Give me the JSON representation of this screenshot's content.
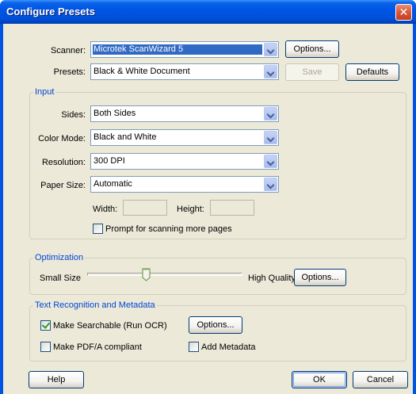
{
  "window": {
    "title": "Configure Presets"
  },
  "scanner": {
    "label": "Scanner:",
    "value": "Microtek ScanWizard 5",
    "options_button": "Options..."
  },
  "presets": {
    "label": "Presets:",
    "value": "Black & White Document",
    "save_button": "Save",
    "defaults_button": "Defaults"
  },
  "input": {
    "group_title": "Input",
    "sides": {
      "label": "Sides:",
      "value": "Both Sides"
    },
    "color_mode": {
      "label": "Color Mode:",
      "value": "Black and White"
    },
    "resolution": {
      "label": "Resolution:",
      "value": "300 DPI"
    },
    "paper_size": {
      "label": "Paper Size:",
      "value": "Automatic"
    },
    "width_label": "Width:",
    "height_label": "Height:",
    "prompt_more": {
      "label": "Prompt for scanning more pages",
      "checked": false
    }
  },
  "optimization": {
    "group_title": "Optimization",
    "min_label": "Small Size",
    "max_label": "High Quality",
    "options_button": "Options...",
    "level": 0.38
  },
  "ocr": {
    "group_title": "Text Recognition and Metadata",
    "make_searchable": {
      "label": "Make Searchable (Run OCR)",
      "checked": true
    },
    "options_button": "Options...",
    "pdfa": {
      "label": "Make PDF/A compliant",
      "checked": false
    },
    "metadata": {
      "label": "Add Metadata",
      "checked": false
    }
  },
  "footer": {
    "help_button": "Help",
    "ok_button": "OK",
    "cancel_button": "Cancel"
  },
  "colors": {
    "titlebar": "#0054e3",
    "dialog_bg": "#ece9d8",
    "group_title": "#0046d5",
    "selection": "#316ac5"
  }
}
